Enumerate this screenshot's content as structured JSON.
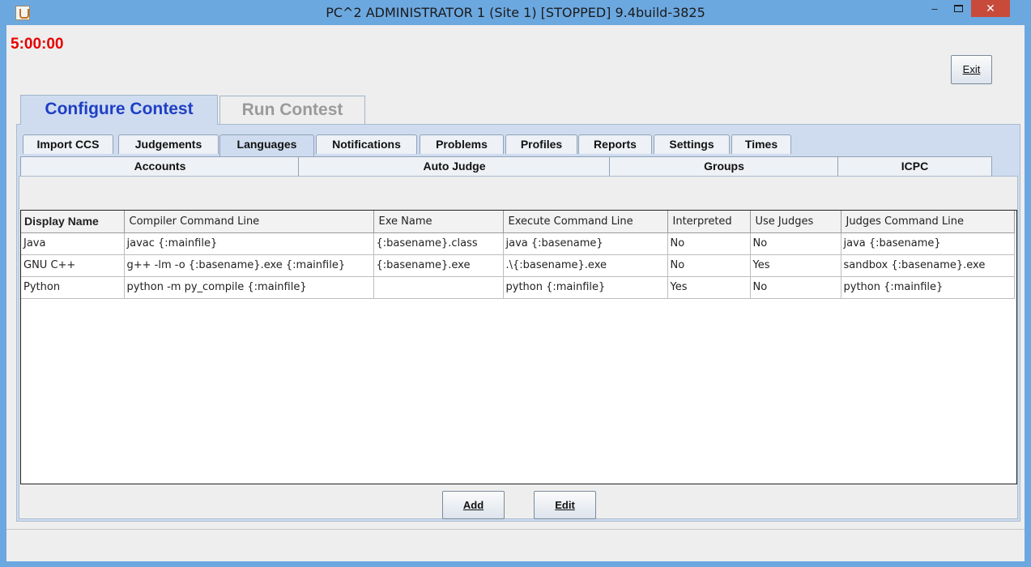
{
  "window": {
    "title": "PC^2 ADMINISTRATOR 1 (Site 1) [STOPPED] 9.4build-3825",
    "minimize_label": "–",
    "close_label": "✕"
  },
  "timer": "5:00:00",
  "exit_button": "Exit",
  "top_tabs": [
    {
      "label": "Configure Contest",
      "active": true
    },
    {
      "label": "Run Contest",
      "active": false
    }
  ],
  "sub_tabs_row1": [
    "Import CCS",
    "Judgements",
    "Languages",
    "Notifications",
    "Problems",
    "Profiles",
    "Reports",
    "Settings",
    "Times"
  ],
  "sub_tabs_row2": [
    "Accounts",
    "Auto Judge",
    "Groups",
    "ICPC"
  ],
  "active_sub_tab": "Languages",
  "table": {
    "columns": [
      "Display Name",
      "Compiler Command Line",
      "Exe Name",
      "Execute Command Line",
      "Interpreted",
      "Use Judges",
      "Judges Command Line"
    ],
    "rows": [
      [
        "Java",
        "javac {:mainfile}",
        "{:basename}.class",
        "java {:basename}",
        "No",
        "No",
        "java {:basename}"
      ],
      [
        "GNU C++",
        "g++ -lm -o {:basename}.exe {:mainfile}",
        "{:basename}.exe",
        ".\\{:basename}.exe",
        "No",
        "Yes",
        "sandbox {:basename}.exe"
      ],
      [
        "Python",
        "python -m py_compile {:mainfile}",
        "",
        "python {:mainfile}",
        "Yes",
        "No",
        "python {:mainfile}"
      ]
    ]
  },
  "buttons": {
    "add": "Add",
    "edit": "Edit"
  }
}
